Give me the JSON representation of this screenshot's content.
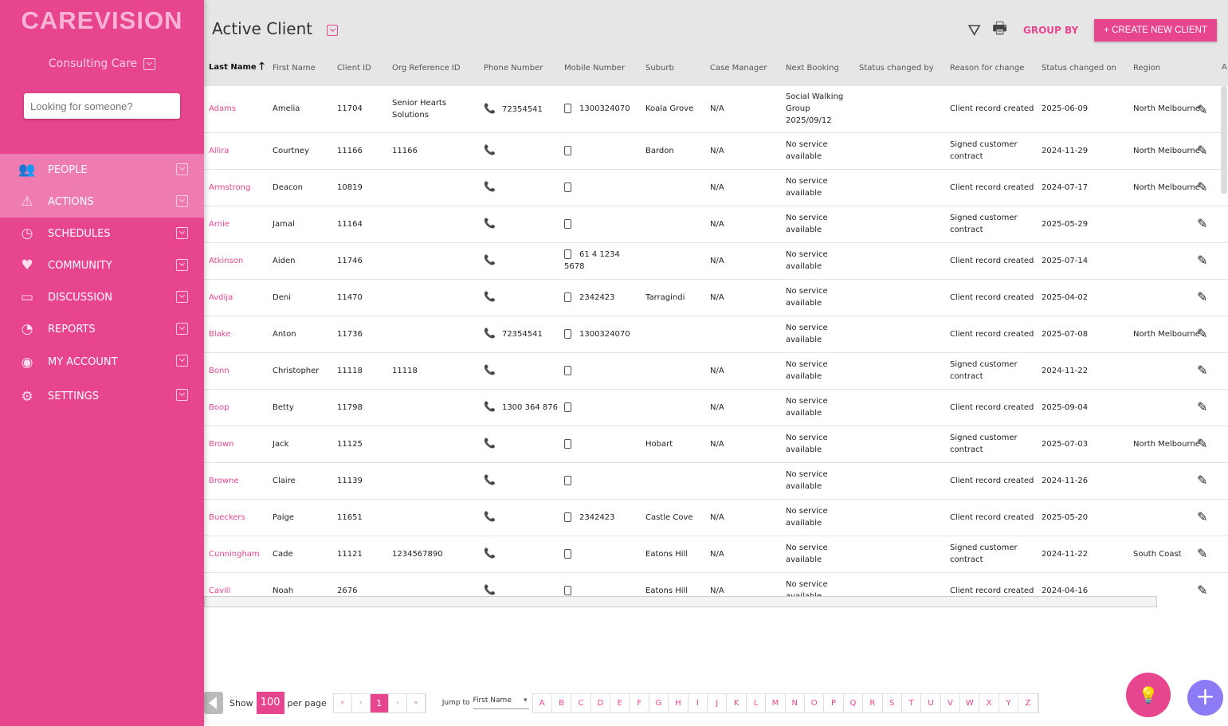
{
  "sidebar": {
    "logo": "CAREVISION",
    "org": "Consulting Care",
    "search_placeholder": "Looking for someone?",
    "items": [
      {
        "label": "PEOPLE",
        "icon": "people-icon",
        "glyph": "👥"
      },
      {
        "label": "ACTIONS",
        "icon": "warning-icon",
        "glyph": "⚠"
      },
      {
        "label": "SCHEDULES",
        "icon": "clock-icon",
        "glyph": "◷"
      },
      {
        "label": "COMMUNITY",
        "icon": "heart-hands-icon",
        "glyph": "♥"
      },
      {
        "label": "DISCUSSION",
        "icon": "chat-icon",
        "glyph": "▭"
      },
      {
        "label": "REPORTS",
        "icon": "gauge-icon",
        "glyph": "◔"
      },
      {
        "label": "MY ACCOUNT",
        "icon": "user-icon",
        "glyph": "◉"
      },
      {
        "label": "SETTINGS",
        "icon": "gear-icon",
        "glyph": "⚙"
      }
    ]
  },
  "header": {
    "title": "Active Client",
    "group_by": "GROUP BY",
    "create": "+ CREATE NEW CLIENT"
  },
  "table": {
    "columns": [
      "Last Name",
      "First Name",
      "Client ID",
      "Org Reference ID",
      "Phone Number",
      "Mobile Number",
      "Suburb",
      "Case Manager",
      "Next Booking",
      "Status changed by",
      "Reason for change",
      "Status changed on",
      "Region"
    ],
    "extra_col": "A",
    "rows": [
      [
        "Adams",
        "Amelia",
        "11704",
        "Senior Hearts Solutions",
        "72354541",
        "1300324070",
        "Koala Grove",
        "N/A",
        "Social Walking Group 2025/09/12",
        "",
        "Client record created",
        "2025-06-09",
        "North Melbourne"
      ],
      [
        "Allira",
        "Courtney",
        "11166",
        "11166",
        "",
        "",
        "Bardon",
        "N/A",
        "No service available",
        "",
        "Signed customer contract",
        "2024-11-29",
        "North Melbourne"
      ],
      [
        "Armstrong",
        "Deacon",
        "10819",
        "",
        "",
        "",
        "",
        "N/A",
        "No service available",
        "",
        "Client record created",
        "2024-07-17",
        "North Melbourne"
      ],
      [
        "Arnie",
        "Jamal",
        "11164",
        "",
        "",
        "",
        "",
        "N/A",
        "No service available",
        "",
        "Signed customer contract",
        "2025-05-29",
        ""
      ],
      [
        "Atkinson",
        "Aiden",
        "11746",
        "",
        "",
        "61 4 1234 5678",
        "",
        "N/A",
        "No service available",
        "",
        "Client record created",
        "2025-07-14",
        ""
      ],
      [
        "Avdija",
        "Deni",
        "11470",
        "",
        "",
        "2342423",
        "Tarragindi",
        "N/A",
        "No service available",
        "",
        "Client record created",
        "2025-04-02",
        ""
      ],
      [
        "Blake",
        "Anton",
        "11736",
        "",
        "72354541",
        "1300324070",
        "",
        "",
        "No service available",
        "",
        "Client record created",
        "2025-07-08",
        "North Melbourne"
      ],
      [
        "Bonn",
        "Christopher",
        "11118",
        "11118",
        "",
        "",
        "",
        "N/A",
        "No service available",
        "",
        "Signed customer contract",
        "2024-11-22",
        ""
      ],
      [
        "Boop",
        "Betty",
        "11798",
        "",
        "1300 364 876",
        "",
        "",
        "N/A",
        "No service available",
        "",
        "Client record created",
        "2025-09-04",
        ""
      ],
      [
        "Brown",
        "Jack",
        "11125",
        "",
        "",
        "",
        "Hobart",
        "N/A",
        "No service available",
        "",
        "Signed customer contract",
        "2025-07-03",
        "North Melbourne"
      ],
      [
        "Browne",
        "Claire",
        "11139",
        "",
        "",
        "",
        "",
        "",
        "No service available",
        "",
        "Client record created",
        "2024-11-26",
        ""
      ],
      [
        "Bueckers",
        "Paige",
        "11651",
        "",
        "",
        "2342423",
        "Castle Cove",
        "N/A",
        "No service available",
        "",
        "Client record created",
        "2025-05-20",
        ""
      ],
      [
        "Cunningham",
        "Cade",
        "11121",
        "1234567890",
        "",
        "",
        "Eatons Hill",
        "N/A",
        "No service available",
        "",
        "Signed customer contract",
        "2024-11-22",
        "South Coast"
      ],
      [
        "Cavill",
        "Noah",
        "2676",
        "",
        "",
        "",
        "Eatons Hill",
        "N/A",
        "No service available",
        "",
        "Client record created",
        "2024-04-16",
        ""
      ]
    ]
  },
  "pager": {
    "show": "Show",
    "per_page_value": "100",
    "per_page": "per page",
    "first": "«",
    "prev": "‹",
    "current": "1",
    "next": "›",
    "last": "»",
    "jump_to": "Jump to",
    "jump_field": "First Name",
    "letters": [
      "A",
      "B",
      "C",
      "D",
      "E",
      "F",
      "G",
      "H",
      "I",
      "J",
      "K",
      "L",
      "M",
      "N",
      "O",
      "P",
      "Q",
      "R",
      "S",
      "T",
      "U",
      "V",
      "W",
      "X",
      "Y",
      "Z"
    ]
  },
  "colors": {
    "accent": "#e8458f",
    "fab": "#8b7cf6"
  }
}
